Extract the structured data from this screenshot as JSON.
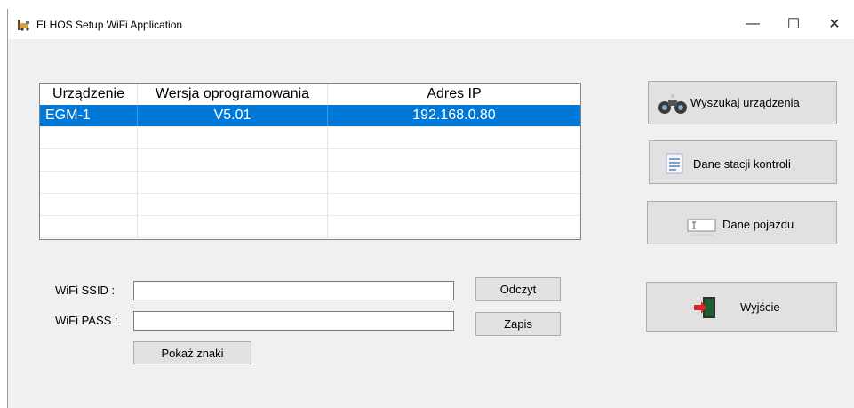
{
  "window": {
    "title": "ELHOS Setup WiFi Application",
    "minimize": "—",
    "maximize": "☐",
    "close": "✕"
  },
  "table": {
    "headers": [
      "Urządzenie",
      "Wersja oprogramowania",
      "Adres IP"
    ],
    "rows": [
      [
        "EGM-1",
        "V5.01",
        "192.168.0.80"
      ]
    ]
  },
  "form": {
    "ssid_label": "WiFi SSID :",
    "pass_label": "WiFi PASS :",
    "ssid_value": "",
    "pass_value": "",
    "read_button": "Odczyt",
    "write_button": "Zapis",
    "show_chars_button": "Pokaż znaki"
  },
  "actions": {
    "search_button": "Wyszukaj urządzenia",
    "station_button": "Dane stacji kontroli",
    "vehicle_button": "Dane pojazdu",
    "exit_button": "Wyjście"
  },
  "colors": {
    "selection": "#0078d7",
    "window_bg": "#f0f0f0",
    "button_bg": "#e1e1e1"
  }
}
